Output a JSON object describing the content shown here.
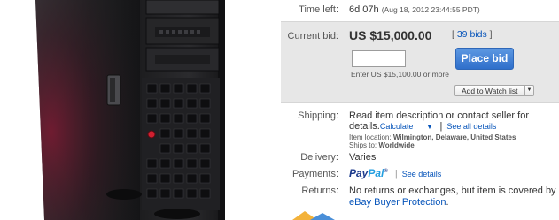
{
  "colors": {
    "link": "#0654ba",
    "place_bid_button": "#3b7bd6",
    "bid_panel_bg": "#e7e7e7"
  },
  "time_left": {
    "label": "Time left:",
    "value": "6d 07h",
    "end_date": "(Aug 18, 2012 23:44:55 PDT)"
  },
  "bid": {
    "label": "Current bid:",
    "price": "US $15,000.00",
    "bids_open": "[",
    "bids_count": "39 bids",
    "bids_close": "]",
    "input_value": "",
    "place_bid_label": "Place bid",
    "hint": "Enter US $15,100.00 or more",
    "watch_label": "Add to Watch list",
    "watch_dropdown_icon": "triangle-down-icon"
  },
  "shipping": {
    "label": "Shipping:",
    "text_line1": "Read item description or contact seller for",
    "text_line2": "details.",
    "calculate_label": "Calculate",
    "calculate_icon": "triangle-down-icon",
    "divider": "|",
    "see_all_label": "See all details",
    "item_location_label": "Item location:",
    "item_location_value": "Wilmington, Delaware, United States",
    "ships_to_label": "Ships to:",
    "ships_to_value": "Worldwide"
  },
  "delivery": {
    "label": "Delivery:",
    "value": "Varies"
  },
  "payments": {
    "label": "Payments:",
    "logo_pay": "Pay",
    "logo_pal": "Pal",
    "logo_tm": "®",
    "divider": "|",
    "see_details_label": "See details"
  },
  "returns": {
    "label": "Returns:",
    "text_line1": "No returns or exchanges, but item is covered by",
    "link_label": "eBay Buyer Protection",
    "text_end": "."
  }
}
